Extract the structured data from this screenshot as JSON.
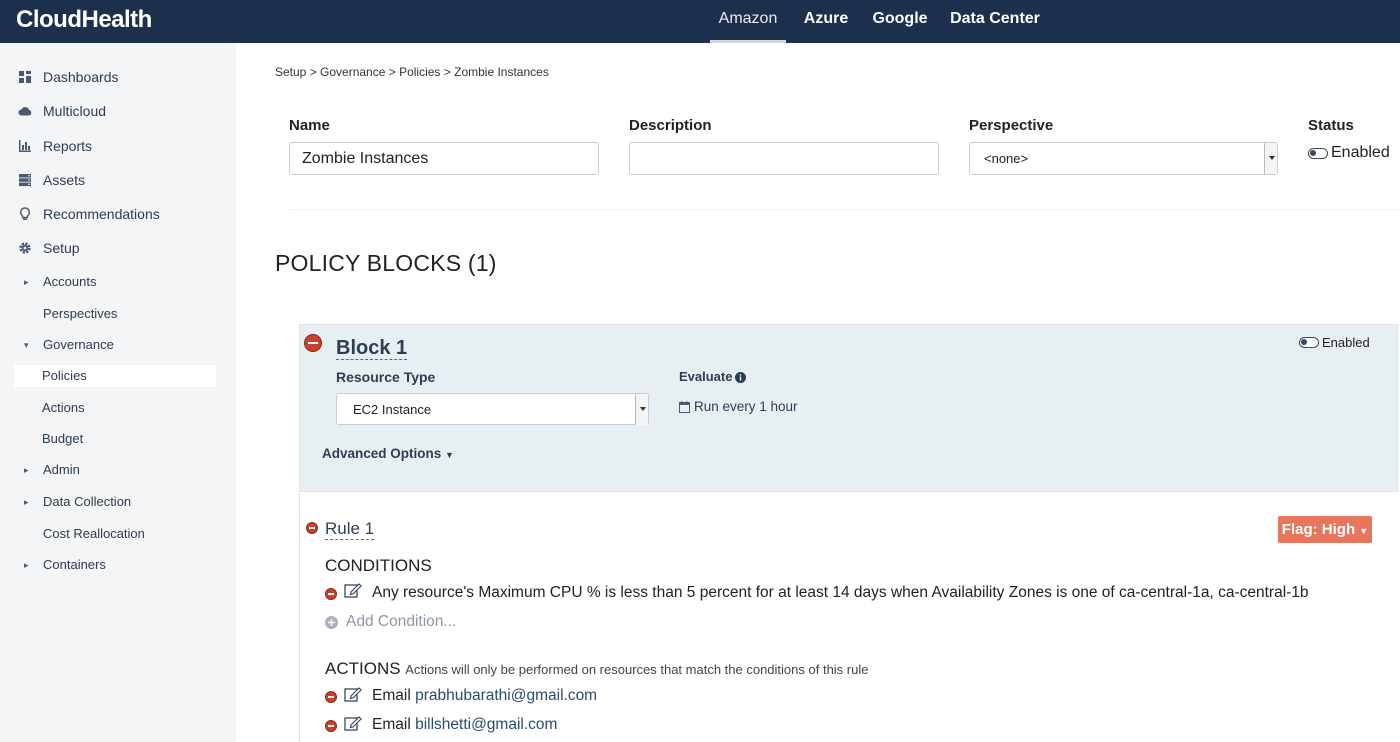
{
  "app": {
    "logo": "CloudHealth"
  },
  "cloud_tabs": [
    {
      "label": "Amazon",
      "active": true
    },
    {
      "label": "Azure",
      "active": false
    },
    {
      "label": "Google",
      "active": false
    },
    {
      "label": "Data Center",
      "active": false
    }
  ],
  "sidebar": {
    "items": [
      {
        "label": "Dashboards",
        "icon": "dashboard-icon"
      },
      {
        "label": "Multicloud",
        "icon": "cloud-icon"
      },
      {
        "label": "Reports",
        "icon": "bar-chart-icon"
      },
      {
        "label": "Assets",
        "icon": "server-icon"
      },
      {
        "label": "Recommendations",
        "icon": "lightbulb-icon"
      },
      {
        "label": "Setup",
        "icon": "gear-icon"
      }
    ],
    "setup_children": [
      {
        "label": "Accounts",
        "caret": "right"
      },
      {
        "label": "Perspectives",
        "caret": ""
      },
      {
        "label": "Governance",
        "caret": "down"
      },
      {
        "label": "Policies",
        "caret": "",
        "active": true
      },
      {
        "label": "Actions",
        "caret": ""
      },
      {
        "label": "Budget",
        "caret": ""
      },
      {
        "label": "Admin",
        "caret": "right"
      },
      {
        "label": "Data Collection",
        "caret": "right"
      },
      {
        "label": "Cost Reallocation",
        "caret": ""
      },
      {
        "label": "Containers",
        "caret": "right"
      }
    ]
  },
  "breadcrumb": "Setup > Governance > Policies > Zombie Instances",
  "form": {
    "name_label": "Name",
    "name_value": "Zombie Instances",
    "description_label": "Description",
    "description_value": "",
    "perspective_label": "Perspective",
    "perspective_value": "<none>",
    "status_label": "Status",
    "status_value": "Enabled"
  },
  "policy_blocks_title": "POLICY BLOCKS (1)",
  "block": {
    "title": "Block 1",
    "status": "Enabled",
    "resource_type_label": "Resource Type",
    "resource_type_value": "EC2 Instance",
    "evaluate_label": "Evaluate",
    "evaluate_value": "Run every 1 hour",
    "advanced_options": "Advanced Options"
  },
  "rule": {
    "title": "Rule 1",
    "flag": "Flag: High",
    "conditions_heading": "CONDITIONS",
    "condition_text": "Any resource's Maximum CPU % is less than 5 percent for at least 14 days when Availability Zones is one of ca-central-1a, ca-central-1b",
    "add_condition": "Add Condition...",
    "actions_heading": "ACTIONS",
    "actions_note": "Actions will only be performed on resources that match the conditions of this rule",
    "actions": [
      {
        "prefix": "Email",
        "target": "prabhubarathi@gmail.com"
      },
      {
        "prefix": "Email",
        "target": "billshetti@gmail.com"
      }
    ]
  },
  "colors": {
    "topbar": "#1c2f4d",
    "sidebar": "#f3f5f7",
    "block_panel": "#e8eff3",
    "flag": "#e8765d",
    "remove": "#c9412c"
  }
}
